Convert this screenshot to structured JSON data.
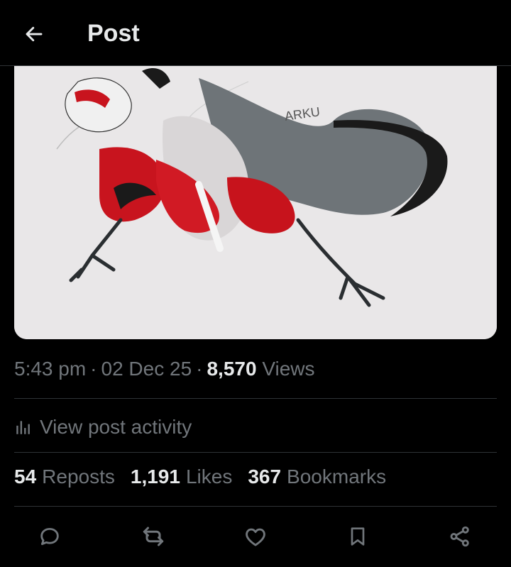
{
  "header": {
    "title": "Post",
    "back_icon": "arrow-left-icon"
  },
  "media": {
    "signature": "ARKU"
  },
  "post_meta": {
    "time": "5:43 pm",
    "separator": "·",
    "date": "02 Dec 25",
    "views_count": "8,570",
    "views_label": "Views"
  },
  "activity": {
    "label": "View post activity",
    "icon": "bar-chart-icon"
  },
  "stats": {
    "reposts_count": "54",
    "reposts_label": "Reposts",
    "likes_count": "1,191",
    "likes_label": "Likes",
    "bookmarks_count": "367",
    "bookmarks_label": "Bookmarks"
  },
  "actions": [
    "reply-icon",
    "repost-icon",
    "like-icon",
    "bookmark-icon",
    "share-icon"
  ],
  "colors": {
    "background": "#000000",
    "primary_text": "#e7e9ea",
    "secondary_text": "#71767b",
    "divider": "#2f3336"
  }
}
